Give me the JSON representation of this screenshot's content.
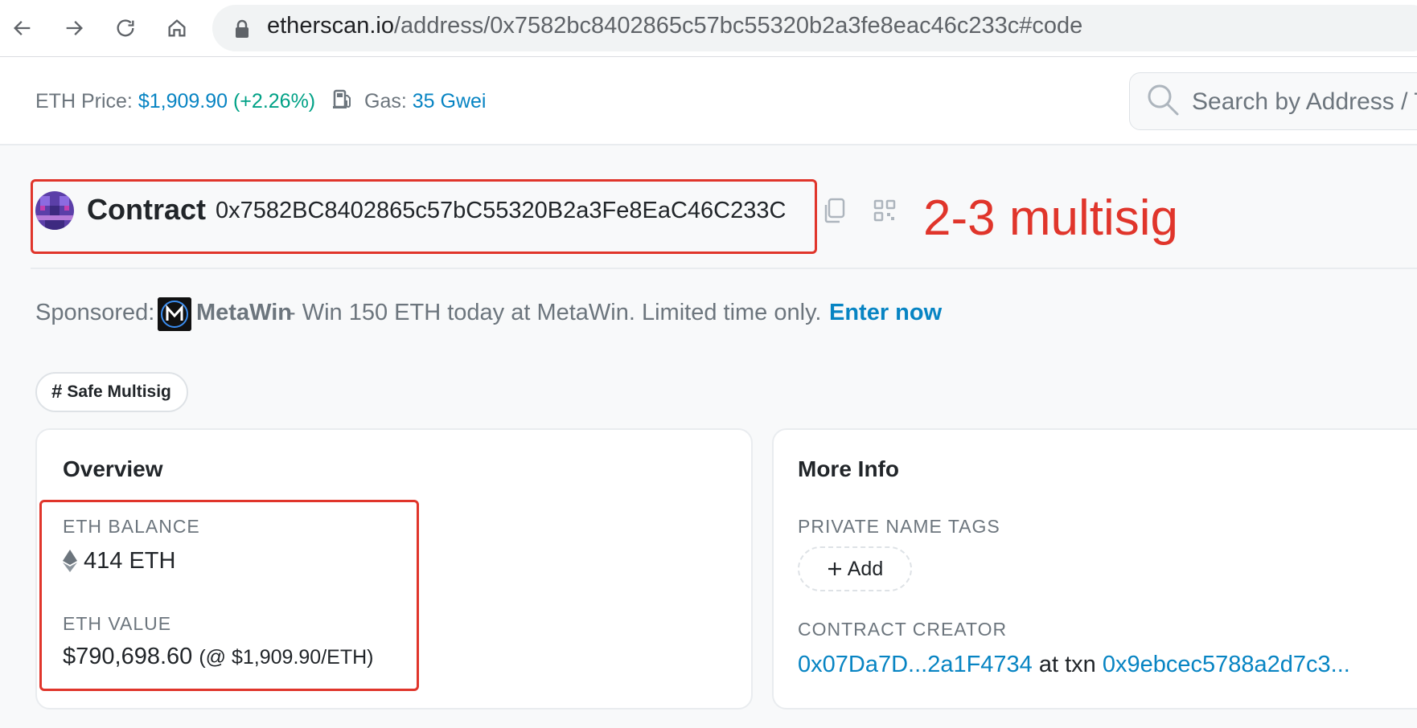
{
  "browser": {
    "url_host": "etherscan.io",
    "url_path": "/address/0x7582bc8402865c57bc55320b2a3fe8eac46c233c#code",
    "icons": [
      "back-icon",
      "forward-icon",
      "reload-icon",
      "home-icon",
      "lock-icon"
    ]
  },
  "topbar": {
    "eth_price_label": "ETH Price:",
    "eth_price_value": "$1,909.90",
    "eth_price_change": "(+2.26%)",
    "gas_label": "Gas:",
    "gas_value": "35 Gwei",
    "search_placeholder": "Search by Address / T"
  },
  "header": {
    "title": "Contract",
    "address": "0x7582BC8402865c57bC55320B2a3Fe8EaC46C233C",
    "annotation": "2-3 multisig"
  },
  "sponsored": {
    "label": "Sponsored:",
    "brand": "MetaWin",
    "text": "- Win 150 ETH today at MetaWin. Limited time only.",
    "cta": "Enter now"
  },
  "tag": {
    "hash": "#",
    "label": "Safe Multisig"
  },
  "overview": {
    "title": "Overview",
    "balance_label": "ETH BALANCE",
    "balance_value": "414 ETH",
    "value_label": "ETH VALUE",
    "value_amount": "$790,698.60",
    "value_rate": "(@ $1,909.90/ETH)"
  },
  "more_info": {
    "title": "More Info",
    "tags_label": "PRIVATE NAME TAGS",
    "add_label": "Add",
    "creator_label": "CONTRACT CREATOR",
    "creator_address": "0x07Da7D...2a1F4734",
    "creator_at": "at txn",
    "creator_txn": "0x9ebcec5788a2d7c3..."
  },
  "colors": {
    "link": "#0784c3",
    "positive": "#00a186",
    "annotation_red": "#e0352b"
  }
}
